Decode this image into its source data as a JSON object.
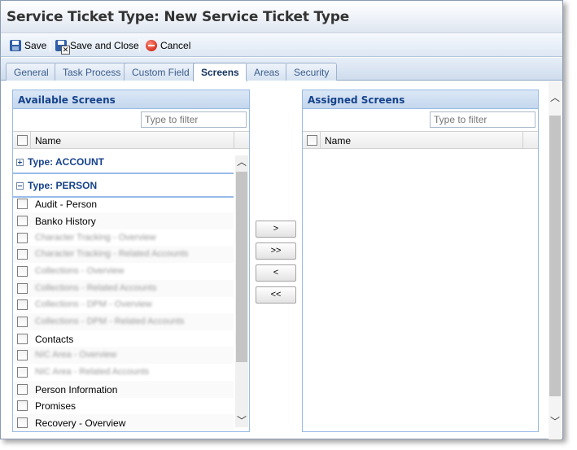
{
  "window": {
    "title": "Service Ticket Type: New Service Ticket Type"
  },
  "toolbar": {
    "save_label": "Save",
    "save_close_label": "Save and Close",
    "cancel_label": "Cancel"
  },
  "tabs": [
    {
      "label": "General",
      "active": false
    },
    {
      "label": "Task Process",
      "active": false
    },
    {
      "label": "Custom Field",
      "active": false
    },
    {
      "label": "Screens",
      "active": true
    },
    {
      "label": "Areas",
      "active": false
    },
    {
      "label": "Security",
      "active": false
    }
  ],
  "available": {
    "title": "Available Screens",
    "filter_placeholder": "Type to filter",
    "column_name": "Name",
    "groups": [
      {
        "label": "Type: ACCOUNT",
        "expanded": false
      },
      {
        "label": "Type: PERSON",
        "expanded": true
      }
    ],
    "items": [
      {
        "label": "Audit - Person",
        "obscured": false
      },
      {
        "label": "Banko History",
        "obscured": false
      },
      {
        "label": "Character Tracking - Overview",
        "obscured": true
      },
      {
        "label": "Character Tracking - Related Accounts",
        "obscured": true
      },
      {
        "label": "Collections - Overview",
        "obscured": true
      },
      {
        "label": "Collections - Related Accounts",
        "obscured": true
      },
      {
        "label": "Collections - DPM - Overview",
        "obscured": true
      },
      {
        "label": "Collections - DPM - Related Accounts",
        "obscured": true
      },
      {
        "label": "Contacts",
        "obscured": false
      },
      {
        "label": "NIC Area - Overview",
        "obscured": true
      },
      {
        "label": "NIC Area - Related Accounts",
        "obscured": true
      },
      {
        "label": "Person Information",
        "obscured": false
      },
      {
        "label": "Promises",
        "obscured": false
      },
      {
        "label": "Recovery - Overview",
        "obscured": false
      }
    ]
  },
  "assigned": {
    "title": "Assigned Screens",
    "filter_placeholder": "Type to filter",
    "column_name": "Name"
  },
  "move_buttons": {
    "add": ">",
    "add_all": ">>",
    "remove": "<",
    "remove_all": "<<"
  },
  "colors": {
    "panel_header_text": "#15428b",
    "panel_border": "#99bbe8",
    "tab_active_text": "#13325e"
  }
}
